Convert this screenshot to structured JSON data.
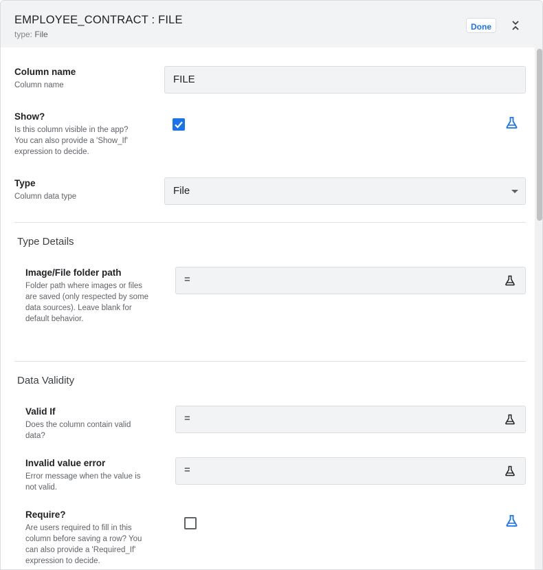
{
  "header": {
    "title": "EMPLOYEE_CONTRACT : FILE",
    "type_prefix": "type:",
    "type_value": "File",
    "done_label": "Done"
  },
  "column_name": {
    "label": "Column name",
    "desc": "Column name",
    "value": "FILE"
  },
  "show": {
    "label": "Show?",
    "desc_lines": [
      "Is this column visible in the app?",
      "You can also provide a 'Show_If'",
      "expression to decide."
    ],
    "checked": true
  },
  "type": {
    "label": "Type",
    "desc": "Column data type",
    "value": "File"
  },
  "type_details": {
    "section_title": "Type Details",
    "folder_path": {
      "label": "Image/File folder path",
      "desc_lines": [
        "Folder path where images or files",
        "are saved (only respected by some",
        "data sources). Leave blank for",
        "default behavior."
      ],
      "value": "="
    }
  },
  "data_validity": {
    "section_title": "Data Validity",
    "valid_if": {
      "label": "Valid If",
      "desc_lines": [
        "Does the column contain valid",
        "data?"
      ],
      "value": "="
    },
    "invalid_error": {
      "label": "Invalid value error",
      "desc_lines": [
        "Error message when the value is",
        "not valid."
      ],
      "value": "="
    },
    "require": {
      "label": "Require?",
      "desc_lines": [
        "Are users required to fill in this",
        "column before saving a row? You",
        "can also provide a 'Required_If'",
        "expression to decide."
      ],
      "checked": false
    }
  },
  "icons": {
    "collapse": "chevrons-collapse-icon",
    "flask": "flask-icon",
    "checkbox_checked": "checkmark-icon",
    "dropdown": "dropdown-arrow-icon"
  },
  "colors": {
    "accent": "#1a73e8",
    "field_bg": "#f1f3f4",
    "header_bg": "#f1f3f4"
  }
}
